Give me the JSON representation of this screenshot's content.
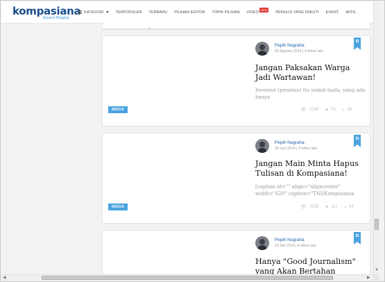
{
  "header": {
    "logo": "kompasiana",
    "tagline": "Beyond Blogging",
    "menu": [
      {
        "label": "KATEGORI",
        "icon": "hamburger-icon",
        "dropdown": true
      },
      {
        "label": "TERPOPULER"
      },
      {
        "label": "TERBARU"
      },
      {
        "label": "PILIHAN EDITOR"
      },
      {
        "label": "TOPIK PILIHAN"
      },
      {
        "label": "VIDEO",
        "badge": "NEW"
      },
      {
        "label": "PENULIS YANG DIIKUTI"
      },
      {
        "label": "EVENT"
      },
      {
        "label": "AFFIL"
      }
    ]
  },
  "articles": [
    {
      "author": "Pepih Nugraha",
      "date": "05 Agustus 2014 | 4 tahun lalu",
      "title": "Jangan Paksakan Warga Jadi Wartawan!",
      "excerpt": "Inventor (penemu) itu sudah tiada, yang ada hanya",
      "tag": "MEDIA",
      "views": "2198",
      "likes": "52",
      "comments": "68"
    },
    {
      "author": "Pepih Nugraha",
      "date": "04 Juni 2014 | 4 tahun lalu",
      "title": "Jangan Main Minta Hapus Tulisan di Kompasiana!",
      "excerpt": "[caption id=\"\" align=\"aligncenter\" width=\"620\" caption=\"TNI/Kompasiana",
      "tag": "MEDIA",
      "views": "3305",
      "likes": "111",
      "comments": "94"
    },
    {
      "author": "Pepih Nugraha",
      "date": "20 Mei 2014 | 4 tahun lalu",
      "title": "Hanya \"Good Journalism\" yang Akan Bertahan"
    }
  ],
  "colors": {
    "brand": "#1a4f8b",
    "accent": "#4aa3df",
    "badge": "#e03a3a"
  }
}
